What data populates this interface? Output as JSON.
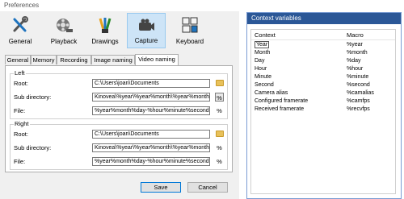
{
  "window": {
    "title": "Preferences"
  },
  "toolbar": {
    "items": [
      {
        "label": "General",
        "icon": "wrench-screwdriver-icon"
      },
      {
        "label": "Playback",
        "icon": "film-reel-icon"
      },
      {
        "label": "Drawings",
        "icon": "brushes-icon"
      },
      {
        "label": "Capture",
        "icon": "camera-icon",
        "active": true
      },
      {
        "label": "Keyboard",
        "icon": "keyboard-icon"
      }
    ]
  },
  "tabs": [
    "General",
    "Memory",
    "Recording",
    "Image naming",
    "Video naming"
  ],
  "active_tab": "Video naming",
  "left": {
    "group": "Left",
    "root_label": "Root:",
    "root": "C:\\Users\\joan\\Documents",
    "sub_label": "Sub directory:",
    "sub": "Kinovea\\%year\\%year%month\\%year%month%d",
    "file_label": "File:",
    "file": "%year%month%day-%hour%minute%second"
  },
  "right": {
    "group": "Right",
    "root_label": "Root:",
    "root": "C:\\Users\\joan\\Documents",
    "sub_label": "Sub directory:",
    "sub": "Kinovea\\%year\\%year%month\\%year%month%d",
    "file_label": "File:",
    "file": "%year%month%day-%hour%minute%second"
  },
  "pct": "%",
  "buttons": {
    "save": "Save",
    "cancel": "Cancel"
  },
  "context": {
    "title": "Context variables",
    "col_context": "Context",
    "col_macro": "Macro",
    "rows": [
      {
        "c": "Year",
        "m": "%year"
      },
      {
        "c": "Month",
        "m": "%month"
      },
      {
        "c": "Day",
        "m": "%day"
      },
      {
        "c": "Hour",
        "m": "%hour"
      },
      {
        "c": "Minute",
        "m": "%minute"
      },
      {
        "c": "Second",
        "m": "%second"
      },
      {
        "c": "Camera alias",
        "m": "%camalias"
      },
      {
        "c": "Configured framerate",
        "m": "%camfps"
      },
      {
        "c": "Received framerate",
        "m": "%recvfps"
      }
    ]
  }
}
